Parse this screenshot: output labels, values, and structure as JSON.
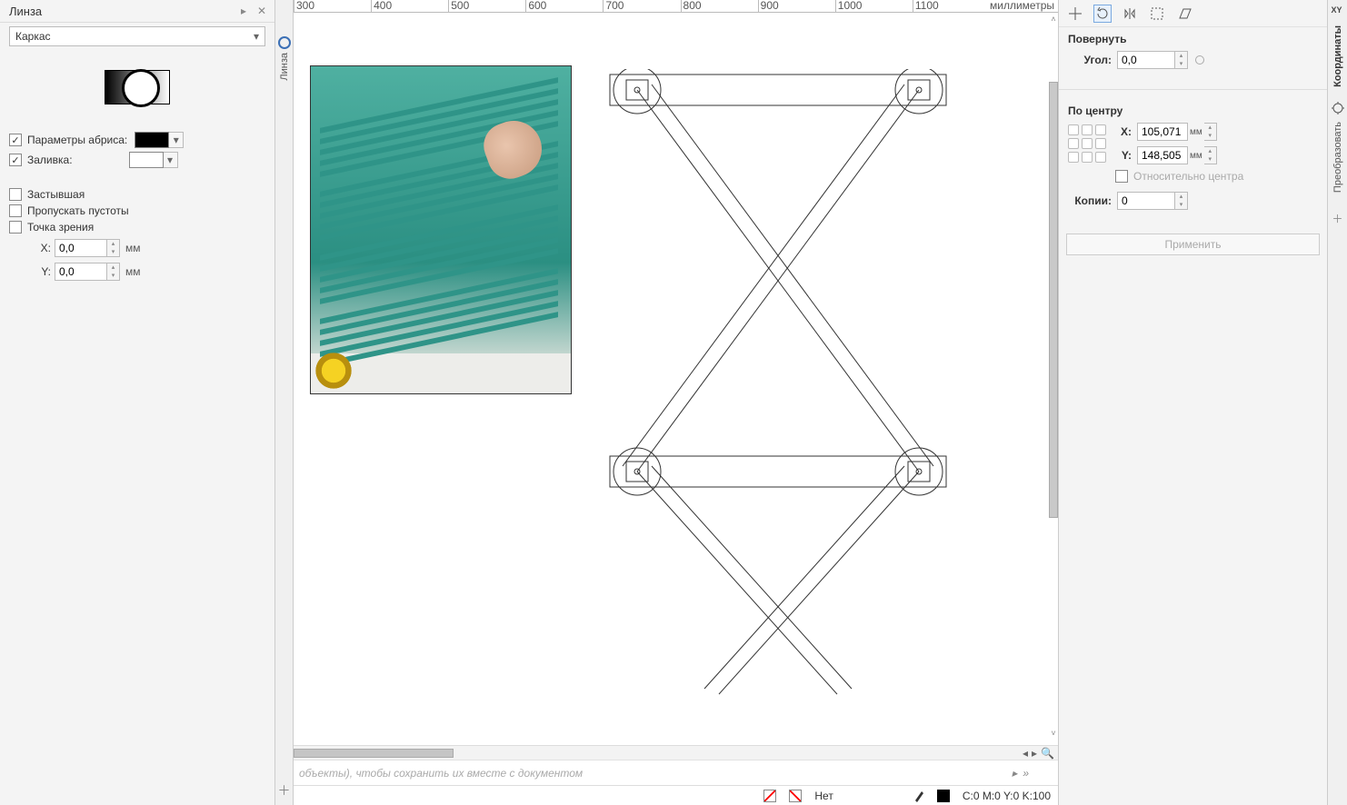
{
  "lens_panel": {
    "title": "Линза",
    "type_selected": "Каркас",
    "outline": {
      "label": "Параметры абриса:",
      "checked": true,
      "color": "#000000"
    },
    "fill": {
      "label": "Заливка:",
      "checked": true,
      "color": "#ffffff"
    },
    "frozen": {
      "label": "Застывшая",
      "checked": false
    },
    "skip_empty": {
      "label": "Пропускать пустоты",
      "checked": false
    },
    "viewpoint": {
      "label": "Точка зрения",
      "checked": false
    },
    "x": {
      "label": "X:",
      "value": "0,0",
      "unit": "мм"
    },
    "y": {
      "label": "Y:",
      "value": "0,0",
      "unit": "мм"
    },
    "rail_tab": "Линза"
  },
  "ruler": {
    "ticks": [
      "300",
      "400",
      "500",
      "600",
      "700",
      "800",
      "900",
      "1000",
      "1100"
    ],
    "unit": "миллиметры"
  },
  "hint_bar": {
    "text": "объекты), чтобы сохранить их вместе с документом"
  },
  "status_bar": {
    "fill_label": "Нет",
    "color_readout": "C:0 M:0 Y:0 K:100"
  },
  "transform": {
    "tabs": [
      "position",
      "rotate",
      "mirror",
      "scale",
      "skew"
    ],
    "active_tab": "rotate",
    "rotate": {
      "title": "Повернуть",
      "angle_label": "Угол:",
      "angle_value": "0,0"
    },
    "center": {
      "title": "По центру",
      "x_label": "X:",
      "x_value": "105,071",
      "x_unit": "мм",
      "y_label": "Y:",
      "y_value": "148,505",
      "y_unit": "мм",
      "relative_label": "Относительно центра",
      "relative_checked": false
    },
    "copies": {
      "label": "Копии:",
      "value": "0"
    },
    "apply": "Применить"
  },
  "right_rail": {
    "tabs": [
      "Координаты",
      "Преобразовать"
    ],
    "icon1": "XY"
  }
}
